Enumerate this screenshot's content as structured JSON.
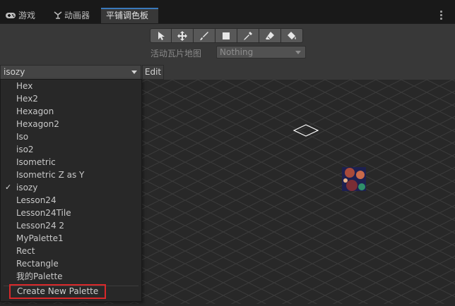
{
  "tabs": [
    {
      "label": "游戏",
      "icon": "gamepad-icon",
      "active": false
    },
    {
      "label": "动画器",
      "icon": "animator-icon",
      "active": false
    },
    {
      "label": "平铺调色板",
      "icon": "",
      "active": true
    }
  ],
  "toolbar": {
    "tools": [
      {
        "name": "select-tool",
        "icon": "arrow-pointer-icon"
      },
      {
        "name": "move-tool",
        "icon": "move-arrows-icon"
      },
      {
        "name": "paint-tool",
        "icon": "brush-icon"
      },
      {
        "name": "box-fill-tool",
        "icon": "rectangle-icon"
      },
      {
        "name": "pick-tool",
        "icon": "eyedropper-icon"
      },
      {
        "name": "erase-tool",
        "icon": "eraser-icon"
      },
      {
        "name": "fill-tool",
        "icon": "paint-bucket-icon"
      }
    ],
    "active_tilemap_label": "活动瓦片地图",
    "active_tilemap_value": "Nothing"
  },
  "palette": {
    "selected": "isozy",
    "edit_label": "Edit",
    "items": [
      "Hex",
      "Hex2",
      "Hexagon",
      "Hexagon2",
      "Iso",
      "iso2",
      "Isometric",
      "Isometric Z as Y",
      "isozy",
      "Lesson24",
      "Lesson24Tile",
      "Lesson24 2",
      "MyPalette1",
      "Rect",
      "Rectangle",
      "我的Palette"
    ],
    "checked_item": "isozy",
    "checkmark": "✓",
    "create_new_label": "Create New Palette"
  },
  "colors": {
    "accent_tab": "#3a79bb",
    "highlight_box": "#d9282a"
  }
}
